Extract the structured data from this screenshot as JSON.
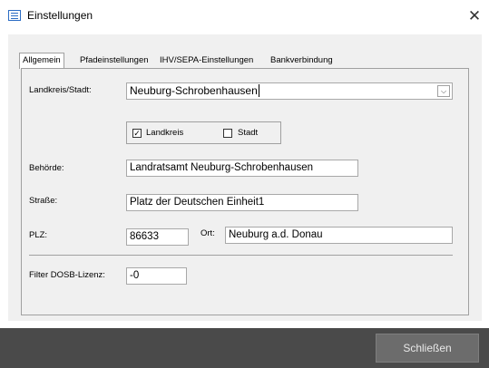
{
  "window": {
    "title": "Einstellungen",
    "close_glyph": "✕"
  },
  "tabs": [
    {
      "label": "Allgemein"
    },
    {
      "label": "Pfadeinstellungen"
    },
    {
      "label": "IHV/SEPA-Einstellungen"
    },
    {
      "label": "Bankverbindung"
    }
  ],
  "form": {
    "landkreis_label": "Landkreis/Stadt:",
    "landkreis_value": "Neuburg-Schrobenhausen",
    "checkbox_landkreis_label": "Landkreis",
    "checkbox_landkreis_checked": true,
    "checkbox_stadt_label": "Stadt",
    "checkbox_stadt_checked": false,
    "behoerde_label": "Behörde:",
    "behoerde_value": "Landratsamt Neuburg-Schrobenhausen",
    "strasse_label": "Straße:",
    "strasse_value": "Platz der Deutschen Einheit1",
    "plz_label": "PLZ:",
    "plz_value": "86633",
    "ort_label": "Ort:",
    "ort_value": "Neuburg a.d. Donau",
    "filter_label": "Filter DOSB-Lizenz:",
    "filter_value": "-0"
  },
  "footer": {
    "close_button_label": "Schließen"
  },
  "icons": {
    "check": "✓",
    "dropdown": "⌵"
  },
  "colors": {
    "footer_bg": "#4a4a4a",
    "button_bg": "#6c6c6c",
    "app_icon": "#2b6cc4"
  }
}
